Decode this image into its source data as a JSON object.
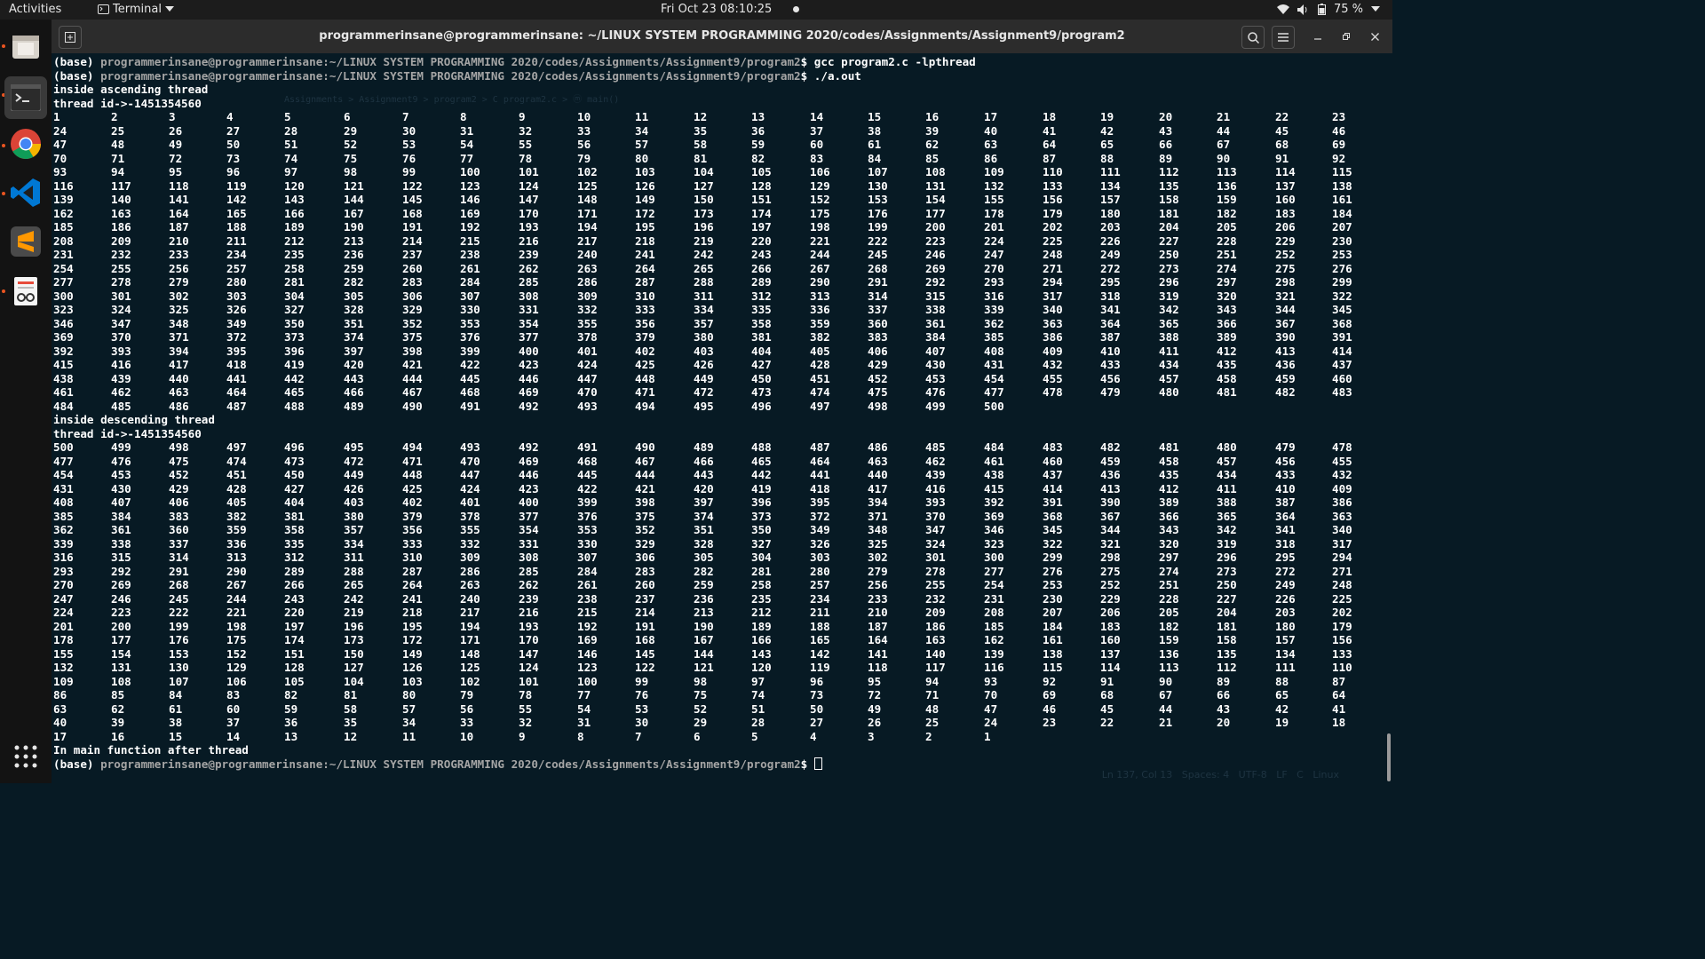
{
  "topbar": {
    "activities": "Activities",
    "app_name": "Terminal",
    "clock": "Fri Oct 23  08:10:25",
    "battery": "75 %"
  },
  "dock": {
    "items": [
      {
        "name": "files",
        "icon": "folder-icon",
        "running": true
      },
      {
        "name": "terminal",
        "icon": "terminal-icon",
        "running": true
      },
      {
        "name": "chrome",
        "icon": "chrome-icon",
        "running": true
      },
      {
        "name": "vscode",
        "icon": "vscode-icon",
        "running": true
      },
      {
        "name": "sublime",
        "icon": "sublime-icon",
        "running": false
      },
      {
        "name": "document-viewer",
        "icon": "document-viewer-icon",
        "running": true
      }
    ],
    "show_apps_icon": "grid-icon"
  },
  "window": {
    "title": "programmerinsane@programmerinsane: ~/LINUX SYSTEM PROGRAMMING 2020/codes/Assignments/Assignment9/program2"
  },
  "terminal": {
    "prompt_prefix": "(base) ",
    "prompt_path": "programmerinsane@programmerinsane:~/LINUX SYSTEM PROGRAMMING 2020/codes/Assignments/Assignment9/program2",
    "prompt_suffix": "$ ",
    "cmd1": "gcc program2.c -lpthread",
    "cmd2": "./a.out",
    "asc_header": "inside ascending thread",
    "asc_tid": "thread id->-1451354560",
    "desc_header": "inside descending thread",
    "desc_tid": "thread id->-1451354560",
    "main_msg": "In main function after thread",
    "sequence_start": 1,
    "sequence_end": 500,
    "columns": 23
  },
  "background_editor": {
    "breadcrumb": "Assignments > Assignment9 > program2 > C program2.c > ⓜ main()",
    "status": "Ln 137, Col 13   Spaces: 4   UTF-8   LF   C   Linux"
  }
}
